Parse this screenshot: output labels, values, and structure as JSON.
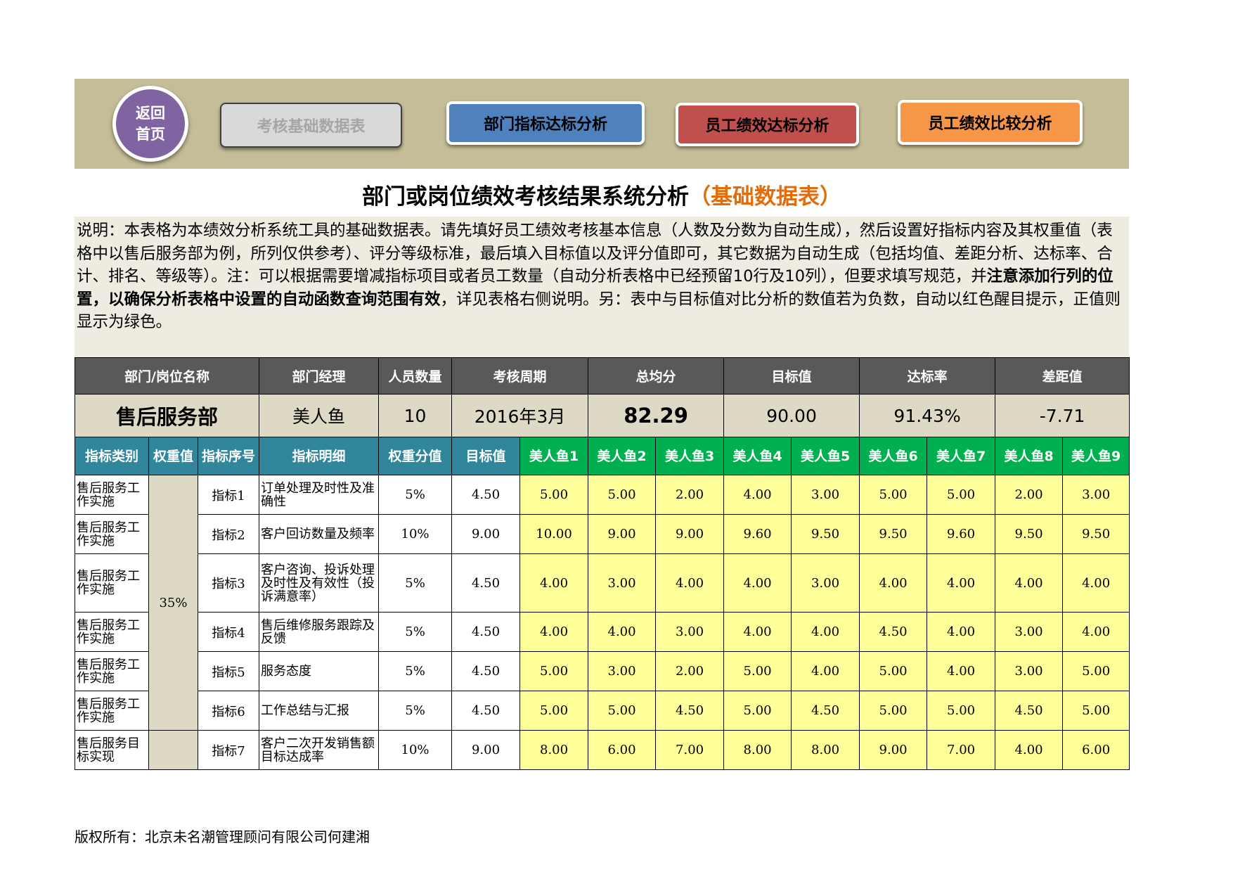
{
  "nav": {
    "home": "返回首页",
    "btn_basic": "考核基础数据表",
    "btn_dept": "部门指标达标分析",
    "btn_emp": "员工绩效达标分析",
    "btn_compare": "员工绩效比较分析"
  },
  "title": {
    "main": "部门或岗位绩效考核结果系统分析",
    "sub": "（基础数据表）"
  },
  "description": {
    "part1": "说明：本表格为本绩效分析系统工具的基础数据表。请先填好员工绩效考核基本信息（人数及分数为自动生成），然后设置好指标内容及其权重值（表格中以售后服务部为例，所列仅供参考）、评分等级标准，最后填入目标值以及评分值即可，其它数据为自动生成（包括均值、差距分析、达标率、合计、排名、等级等）。注：可以根据需要增减指标项目或者员工数量（自动分析表格中已经预留10行及10列），但要求填写规范，并",
    "bold": "注意添加行列的位置，以确保分析表格中设置的自动函数查询范围有效",
    "part2": "，详见表格右侧说明。另：表中与目标值对比分析的数值若为负数，自动以红色醒目提示，正值则显示为绿色。"
  },
  "summary_headers": {
    "dept": "部门/岗位名称",
    "manager": "部门经理",
    "count": "人员数量",
    "period": "考核周期",
    "avg": "总均分",
    "target": "目标值",
    "rate": "达标率",
    "gap": "差距值"
  },
  "summary": {
    "dept": "售后服务部",
    "manager": "美人鱼",
    "count": "10",
    "period": "2016年3月",
    "avg": "82.29",
    "target": "90.00",
    "rate": "91.43%",
    "gap": "-7.71"
  },
  "indicator_headers": {
    "category": "指标类别",
    "weight": "权重值",
    "seq": "指标序号",
    "detail": "指标明细",
    "weight_score": "权重分值",
    "target": "目标值",
    "employees": [
      "美人鱼1",
      "美人鱼2",
      "美人鱼3",
      "美人鱼4",
      "美人鱼5",
      "美人鱼6",
      "美人鱼7",
      "美人鱼8",
      "美人鱼9"
    ]
  },
  "weight_group": "35%",
  "rows": [
    {
      "category": "售后服务工作实施",
      "seq": "指标1",
      "detail": "订单处理及时性及准确性",
      "ws": "5%",
      "target": "4.50",
      "scores": [
        "5.00",
        "5.00",
        "2.00",
        "4.00",
        "3.00",
        "5.00",
        "5.00",
        "2.00",
        "3.00"
      ]
    },
    {
      "category": "售后服务工作实施",
      "seq": "指标2",
      "detail": "客户回访数量及频率",
      "ws": "10%",
      "target": "9.00",
      "scores": [
        "10.00",
        "9.00",
        "9.00",
        "9.60",
        "9.50",
        "9.50",
        "9.60",
        "9.50",
        "9.50"
      ]
    },
    {
      "category": "售后服务工作实施",
      "seq": "指标3",
      "detail": "客户咨询、投诉处理及时性及有效性（投诉满意率）",
      "ws": "5%",
      "target": "4.50",
      "scores": [
        "4.00",
        "3.00",
        "4.00",
        "4.00",
        "3.00",
        "4.00",
        "4.00",
        "4.00",
        "4.00"
      ]
    },
    {
      "category": "售后服务工作实施",
      "seq": "指标4",
      "detail": "售后维修服务跟踪及反馈",
      "ws": "5%",
      "target": "4.50",
      "scores": [
        "4.00",
        "4.00",
        "3.00",
        "4.00",
        "4.00",
        "4.50",
        "4.00",
        "3.00",
        "4.00"
      ]
    },
    {
      "category": "售后服务工作实施",
      "seq": "指标5",
      "detail": "服务态度",
      "ws": "5%",
      "target": "4.50",
      "scores": [
        "5.00",
        "3.00",
        "2.00",
        "5.00",
        "4.00",
        "5.00",
        "4.00",
        "3.00",
        "5.00"
      ]
    },
    {
      "category": "售后服务工作实施",
      "seq": "指标6",
      "detail": "工作总结与汇报",
      "ws": "5%",
      "target": "4.50",
      "scores": [
        "5.00",
        "5.00",
        "4.50",
        "5.00",
        "4.50",
        "5.00",
        "5.00",
        "4.50",
        "5.00"
      ]
    },
    {
      "category": "售后服务目标实现",
      "seq": "指标7",
      "detail": "客户二次开发销售额目标达成率",
      "ws": "10%",
      "target": "9.00",
      "scores": [
        "8.00",
        "6.00",
        "7.00",
        "8.00",
        "8.00",
        "9.00",
        "7.00",
        "4.00",
        "6.00"
      ]
    }
  ],
  "copyright": "版权所有：北京未名潮管理顾问有限公司何建湘"
}
